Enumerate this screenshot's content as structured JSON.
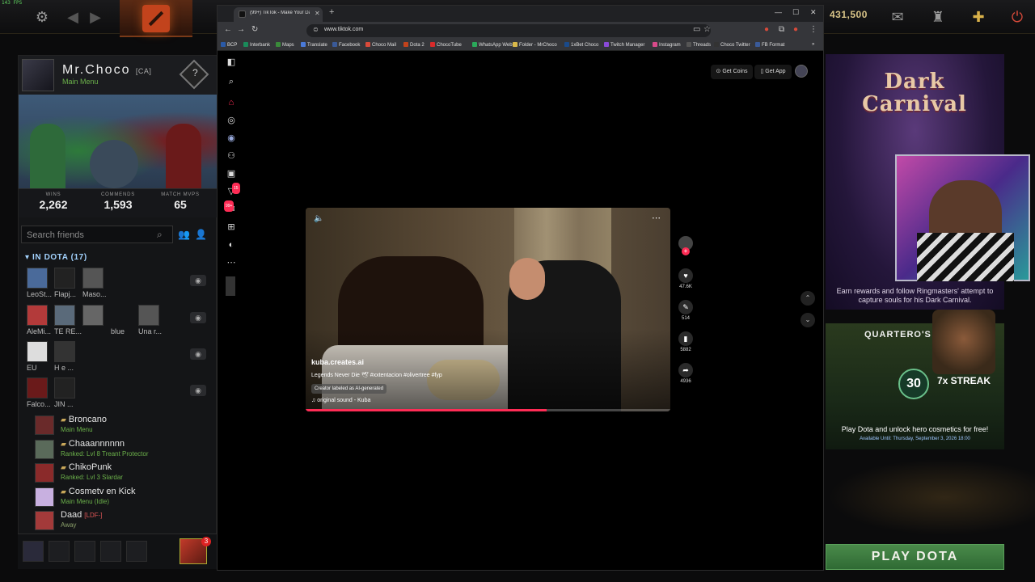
{
  "system": {
    "fps": "143 FPS"
  },
  "dota_top": {
    "gold": "431,500"
  },
  "profile": {
    "name": "Mr.Choco",
    "tag": "[CA]",
    "status": "Main Menu",
    "stats": [
      {
        "label": "WINS",
        "value": "2,262"
      },
      {
        "label": "COMMENDS",
        "value": "1,593"
      },
      {
        "label": "MATCH MVPS",
        "value": "65"
      }
    ]
  },
  "friends": {
    "search_placeholder": "Search friends",
    "in_dota_header": "IN DOTA (17)",
    "ingame_rows": [
      {
        "names": [
          "LeoSt...",
          "Flapj...",
          "Maso..."
        ],
        "avatar_colors": [
          "#4a6a9a",
          "#222222",
          "#555555"
        ]
      },
      {
        "names": [
          "AleMi...",
          "TE RE...",
          "",
          "blue",
          "Una r..."
        ],
        "avatar_colors": [
          "#b33a3a",
          "#5a6a7a",
          "#666666",
          "",
          "#555555"
        ]
      },
      {
        "names": [
          "EU",
          "H e ..."
        ],
        "avatar_colors": [
          "#dddddd",
          "#333333"
        ]
      },
      {
        "names": [
          "Falco...",
          "JIN ..."
        ],
        "avatar_colors": [
          "#6a1a1a",
          "#222222"
        ]
      }
    ],
    "list": [
      {
        "name": "Broncano",
        "status": "Main Menu",
        "color": "#6a2a2a"
      },
      {
        "name": "Chaaannnnnn",
        "status": "Ranked: Lvl 8 Treant Protector",
        "color": "#5a6a5a"
      },
      {
        "name": "ChikoPunk",
        "status": "Ranked: Lvl 3 Slardar",
        "color": "#8a2a2a"
      },
      {
        "name": "Cosmetv en Kick",
        "status": "Main Menu (Idle)",
        "color": "#c8b0e0"
      },
      {
        "name": "Daad",
        "tag": "[LDF-]",
        "status": "Away",
        "color": "#a33a3a"
      }
    ],
    "chat_badge": "3"
  },
  "browser": {
    "tab_title": "(99+) TikTok - Make Your Day",
    "url": "www.tiktok.com",
    "bookmarks": [
      {
        "label": "BCP",
        "color": "#2a5aa8"
      },
      {
        "label": "Interbank",
        "color": "#1a8a5a"
      },
      {
        "label": "Maps",
        "color": "#3a8a3a"
      },
      {
        "label": "Translate",
        "color": "#4a7ad8"
      },
      {
        "label": "Facebook",
        "color": "#3a5a98"
      },
      {
        "label": "Choco Mail",
        "color": "#d84a3a"
      },
      {
        "label": "Dota 2",
        "color": "#c2431c"
      },
      {
        "label": "ChocoTube",
        "color": "#d82a2a"
      },
      {
        "label": "WhatsApp Web",
        "color": "#2aa85a"
      },
      {
        "label": "Folder - MrChoco",
        "color": "#d8b84a"
      },
      {
        "label": "1xBet Choco",
        "color": "#1a4a8a"
      },
      {
        "label": "Twitch Manager",
        "color": "#8a4ad8"
      },
      {
        "label": "Instagram",
        "color": "#d84a8a"
      },
      {
        "label": "Threads",
        "color": "#555555"
      },
      {
        "label": "Choco Twitter",
        "color": "#333333"
      },
      {
        "label": "FB Format",
        "color": "#3a5a98"
      }
    ]
  },
  "tiktok": {
    "get_coins": "Get Coins",
    "get_app": "Get App",
    "nav_badges": {
      "inbox": "15",
      "messages": "99+"
    },
    "video": {
      "author": "kuba.creates.ai",
      "caption": "Legends Never Die 🕊 #xxtentacion #olivertree #fyp",
      "ai_label": "Creator labeled as AI-generated",
      "sound": "original sound - Kuba",
      "progress": 0.66
    },
    "actions": [
      {
        "name": "like",
        "icon": "heart-icon",
        "count": "47.6K"
      },
      {
        "name": "comment",
        "icon": "comment-icon",
        "count": "514"
      },
      {
        "name": "bookmark",
        "icon": "bookmark-icon",
        "count": "5882"
      },
      {
        "name": "share",
        "icon": "share-icon",
        "count": "4936"
      }
    ]
  },
  "right": {
    "carnival_title": "Dark Carnival",
    "carnival_desc": "Earn rewards and follow Ringmasters' attempt to capture souls for his Dark Carnival.",
    "quarteros_title": "QUARTERO'S C",
    "streak_number": "30",
    "streak_label": "7x STREAK",
    "quarteros_desc": "Play Dota and unlock hero cosmetics for free!",
    "quarteros_until": "Available Until:  Thursday, September 3, 2026 18:00",
    "play_button": "PLAY DOTA"
  }
}
